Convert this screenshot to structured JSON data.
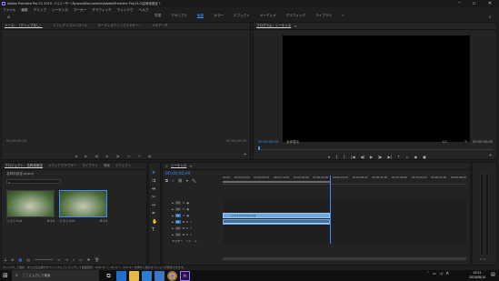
{
  "app": {
    "title": "Adobe Premiere Pro CC 2019 - C:\\ユーザー\\Ryuzou\\Documents\\Adobe\\Premiere Pro\\13.0\\名称未設定 *",
    "window_controls": [
      "minimize",
      "maximize",
      "close"
    ]
  },
  "menubar": {
    "items": [
      "ファイル",
      "編集",
      "クリップ",
      "シーケンス",
      "マーカー",
      "グラフィック",
      "ウィンドウ",
      "ヘルプ"
    ]
  },
  "workspaces": {
    "items": [
      "学習",
      "アセンブリ",
      "編集",
      "カラー",
      "エフェクト",
      "オーディオ",
      "グラフィック",
      "ライブラリ"
    ],
    "active": "編集",
    "more": "»"
  },
  "source_panel": {
    "tabs": [
      "ソース：（クリップなし）",
      "エフェクトコントロール",
      "オーディオクリップミキサー：",
      "メタデータ"
    ],
    "timecode_left": "00:00:00:00",
    "timecode_right": "00:00:00:00"
  },
  "program_panel": {
    "tabs": [
      "プログラム：シーケンス"
    ],
    "timecode_left": "00:00:00:00",
    "fit": "全体表示",
    "ratio": "1/2",
    "timecode_right": "00:00:00:00"
  },
  "project_panel": {
    "tabs": [
      "プロジェクト：名称未設定",
      "メディアブラウザー",
      "ライブラリ",
      "情報",
      "エフェクト"
    ],
    "project_file": "名称未設定.prproj",
    "clips": [
      {
        "name": "リストCut",
        "duration": "6:24"
      },
      {
        "name": "リストCut",
        "duration": "6:24"
      }
    ]
  },
  "timeline": {
    "tab": "シーケンス",
    "timecode": "00;00;00;00",
    "ruler": [
      "00:00",
      "00;00;04;00",
      "00;00;08;00",
      "00;00;12;00",
      "00;00;16;00",
      "00;00;20;00",
      "00;00;24;00",
      "00;00;28;00",
      "00;00;32;00",
      "00;00;36;00",
      "00;00;40;00",
      "00;00;44;00",
      "00;00;48;00"
    ],
    "video_tracks": [
      "V3",
      "V2",
      "V1"
    ],
    "audio_tracks": [
      "A1",
      "A2",
      "A3"
    ],
    "master": "マスター",
    "master_value": "0.0",
    "video_clip_name": "リストCut.mp4 [V]"
  },
  "status_bar": {
    "text": "クリックして選択、または空白部分をクリックしてドラッグして範囲選択。Shift キー、Alt キー、Ctrl キーを押すと他のオプションが使用できます。"
  },
  "taskbar": {
    "search_placeholder": "ここに入力して検索",
    "time": "19:21",
    "date": "2019/08/10",
    "lang": "A"
  },
  "colors": {
    "accent_blue": "#3c8cff",
    "clip_video": "#6ea7d8",
    "clip_audio": "#3f6fa0",
    "panel_bg": "#232323",
    "taskbar_bg": "#101010"
  }
}
